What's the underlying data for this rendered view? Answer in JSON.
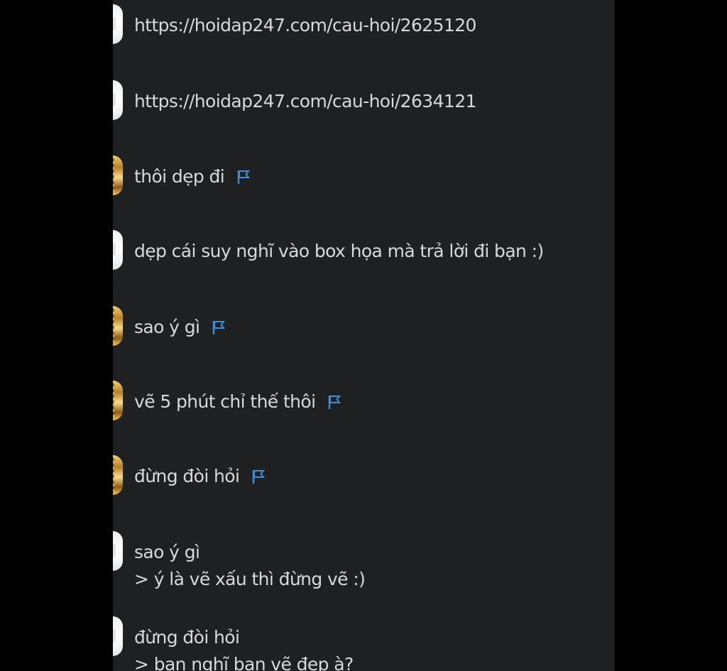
{
  "chat": {
    "messages": [
      {
        "avatar": "white-avatar",
        "lines": [
          "https://hoidap247.com/cau-hoi/2625120"
        ],
        "flag": false
      },
      {
        "avatar": "white-avatar",
        "lines": [
          "https://hoidap247.com/cau-hoi/2634121"
        ],
        "flag": false
      },
      {
        "avatar": "gold-avatar",
        "lines": [
          "thôi dẹp đi"
        ],
        "flag": true
      },
      {
        "avatar": "white-avatar",
        "lines": [
          "dẹp cái suy nghĩ vào box họa mà trả lời đi bạn :)"
        ],
        "flag": false
      },
      {
        "avatar": "gold-avatar",
        "lines": [
          "sao ý gì"
        ],
        "flag": true
      },
      {
        "avatar": "gold-avatar",
        "lines": [
          "vẽ 5 phút chỉ thế thôi"
        ],
        "flag": true
      },
      {
        "avatar": "gold-avatar",
        "lines": [
          "đừng đòi hỏi"
        ],
        "flag": true
      },
      {
        "avatar": "white-avatar",
        "lines": [
          "sao ý gì",
          "> ý là vẽ xấu thì đừng vẽ :)"
        ],
        "flag": false
      },
      {
        "avatar": "white-avatar",
        "lines": [
          "đừng đòi hỏi",
          "> ban nghĩ ban vẽ đep à?"
        ],
        "flag": false
      }
    ]
  },
  "colors": {
    "panel_bg": "#1f2022",
    "outer_bg": "#000000",
    "text": "#d8d8d8",
    "flag": "#3d8fd8"
  },
  "icons": {
    "flag": "flag-icon"
  }
}
